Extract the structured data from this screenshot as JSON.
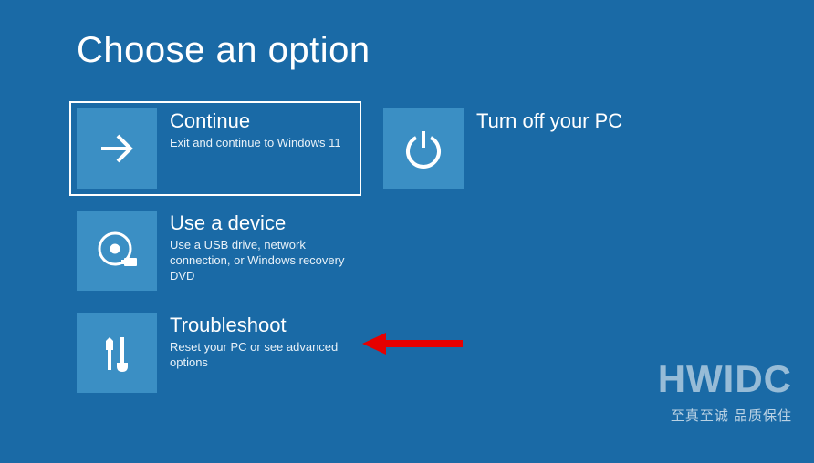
{
  "title": "Choose an option",
  "options": {
    "continue": {
      "title": "Continue",
      "desc": "Exit and continue to Windows 11"
    },
    "turnoff": {
      "title": "Turn off your PC",
      "desc": ""
    },
    "device": {
      "title": "Use a device",
      "desc": "Use a USB drive, network connection, or Windows recovery DVD"
    },
    "troubleshoot": {
      "title": "Troubleshoot",
      "desc": "Reset your PC or see advanced options"
    }
  },
  "watermark": {
    "main": "HWIDC",
    "sub": "至真至诚 品质保住"
  }
}
